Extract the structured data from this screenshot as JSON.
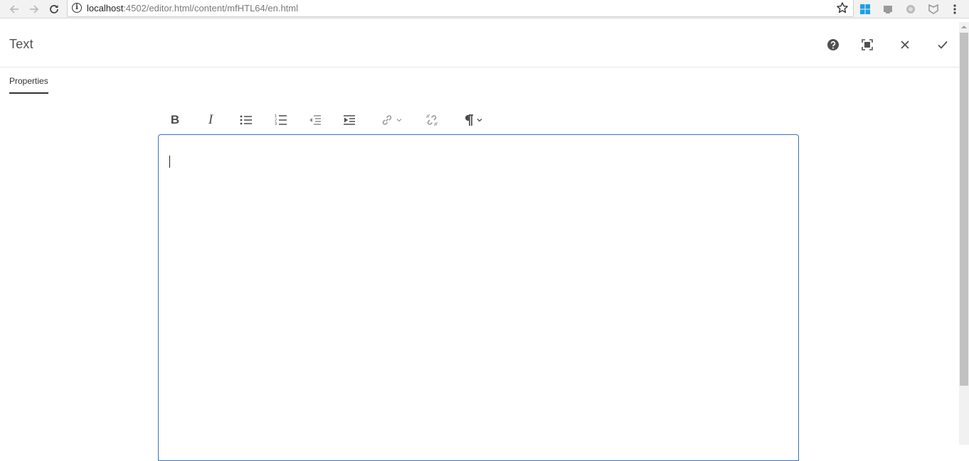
{
  "browser": {
    "url_host": "localhost",
    "url_path": ":4502/editor.html/content/mfHTL64/en.html",
    "nav_icons": [
      "back-arrow-icon",
      "forward-arrow-icon",
      "reload-icon"
    ],
    "extension_icons": [
      "windows-icon",
      "screen-icon",
      "circle-icon",
      "shield-icon",
      "menu-dots-icon"
    ]
  },
  "dialog": {
    "title": "Text",
    "header_buttons": [
      "help-icon",
      "fullscreen-icon",
      "close-icon",
      "check-icon"
    ]
  },
  "tabs": [
    {
      "label": "Properties",
      "active": true
    }
  ],
  "rte": {
    "toolbar": {
      "bold_label": "B",
      "italic_label": "I",
      "tools": [
        "bold",
        "italic",
        "bullet-list",
        "numbered-list",
        "outdent",
        "indent",
        "link",
        "unlink",
        "paragraph-format"
      ]
    },
    "content": ""
  },
  "colors": {
    "editor_border": "#3a74b5",
    "text": "#4b4b4b",
    "scrollbar_thumb": "#c1c1c1"
  }
}
